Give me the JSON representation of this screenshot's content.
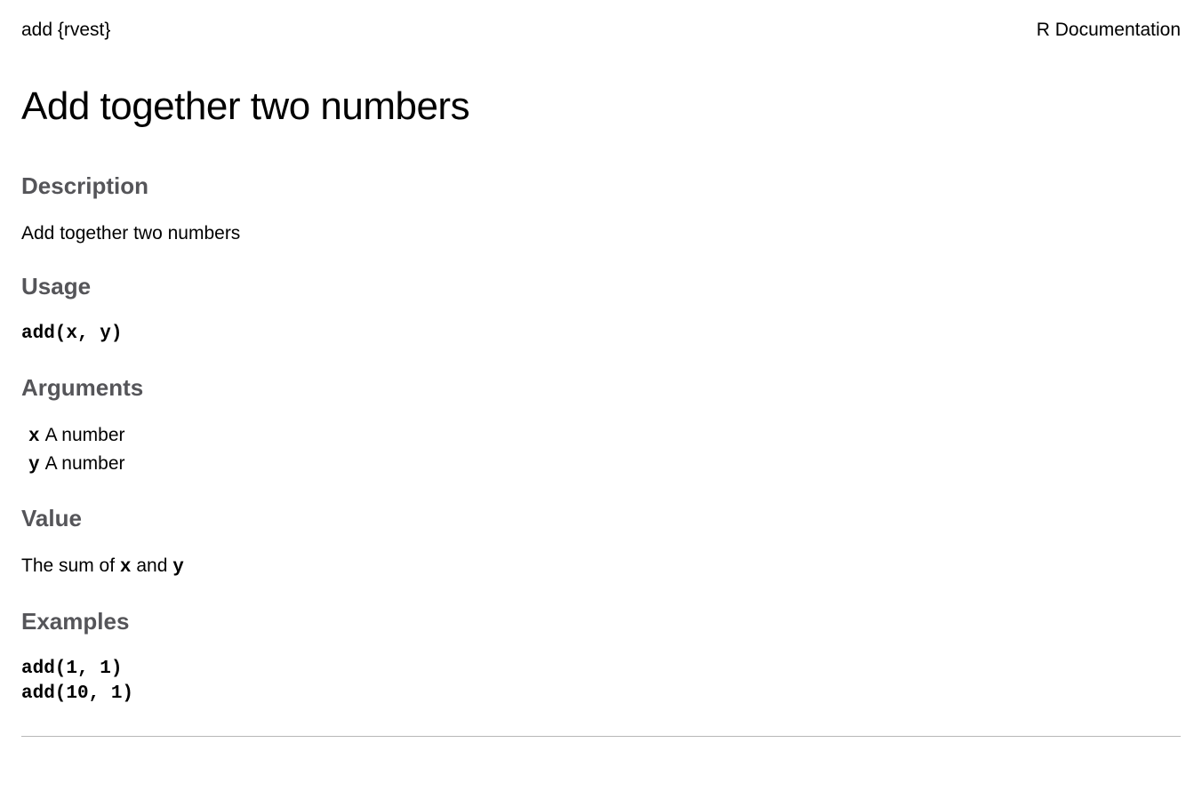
{
  "header": {
    "left": "add {rvest}",
    "right": "R Documentation"
  },
  "title": "Add together two numbers",
  "sections": {
    "description": {
      "heading": "Description",
      "text": "Add together two numbers"
    },
    "usage": {
      "heading": "Usage",
      "code": "add(x, y)"
    },
    "arguments": {
      "heading": "Arguments",
      "items": [
        {
          "name": "x",
          "desc": "A number"
        },
        {
          "name": "y",
          "desc": "A number"
        }
      ]
    },
    "value": {
      "heading": "Value",
      "prefix": "The sum of ",
      "code1": "x",
      "mid": " and ",
      "code2": "y"
    },
    "examples": {
      "heading": "Examples",
      "code": "add(1, 1)\nadd(10, 1)"
    }
  }
}
